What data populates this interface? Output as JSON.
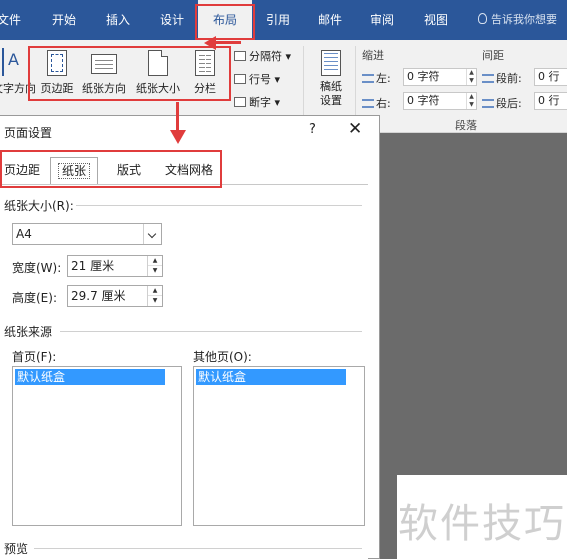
{
  "ribbon_tabs": [
    "文件",
    "开始",
    "插入",
    "设计",
    "布局",
    "引用",
    "邮件",
    "审阅",
    "视图"
  ],
  "tell_me": "告诉我你想要",
  "ribbon": {
    "text_direction": "文字方向",
    "margins": "页边距",
    "orientation": "纸张方向",
    "size": "纸张大小",
    "columns": "分栏",
    "breaks": "分隔符",
    "line_numbers": "行号",
    "hyphenation": "断字",
    "draft_paper": "稿纸\n设置",
    "indent_label": "缩进",
    "spacing_label": "间距",
    "indent_left_label": "左:",
    "indent_left_value": "0 字符",
    "indent_right_label": "右:",
    "indent_right_value": "0 字符",
    "spacing_before_label": "段前:",
    "spacing_before_value": "0 行",
    "spacing_after_label": "段后:",
    "spacing_after_value": "0 行",
    "paragraph_group": "段落",
    "draft_label": "稿纸"
  },
  "dialog": {
    "title": "页面设置",
    "help": "?",
    "close": "✕",
    "tabs": [
      "页边距",
      "纸张",
      "版式",
      "文档网格"
    ],
    "paper_size_section": "纸张大小(R):",
    "paper_size_value": "A4",
    "width_label": "宽度(W):",
    "width_value": "21 厘米",
    "height_label": "高度(E):",
    "height_value": "29.7 厘米",
    "paper_source_section": "纸张来源",
    "first_page_label": "首页(F):",
    "other_pages_label": "其他页(O):",
    "first_page_item": "默认纸盒",
    "other_pages_item": "默认纸盒",
    "preview_section": "预览"
  },
  "watermark": "软件技巧",
  "colors": {
    "ribbon_blue": "#2b579a",
    "highlight_red": "#e03c3c",
    "selection_blue": "#3399ff"
  }
}
